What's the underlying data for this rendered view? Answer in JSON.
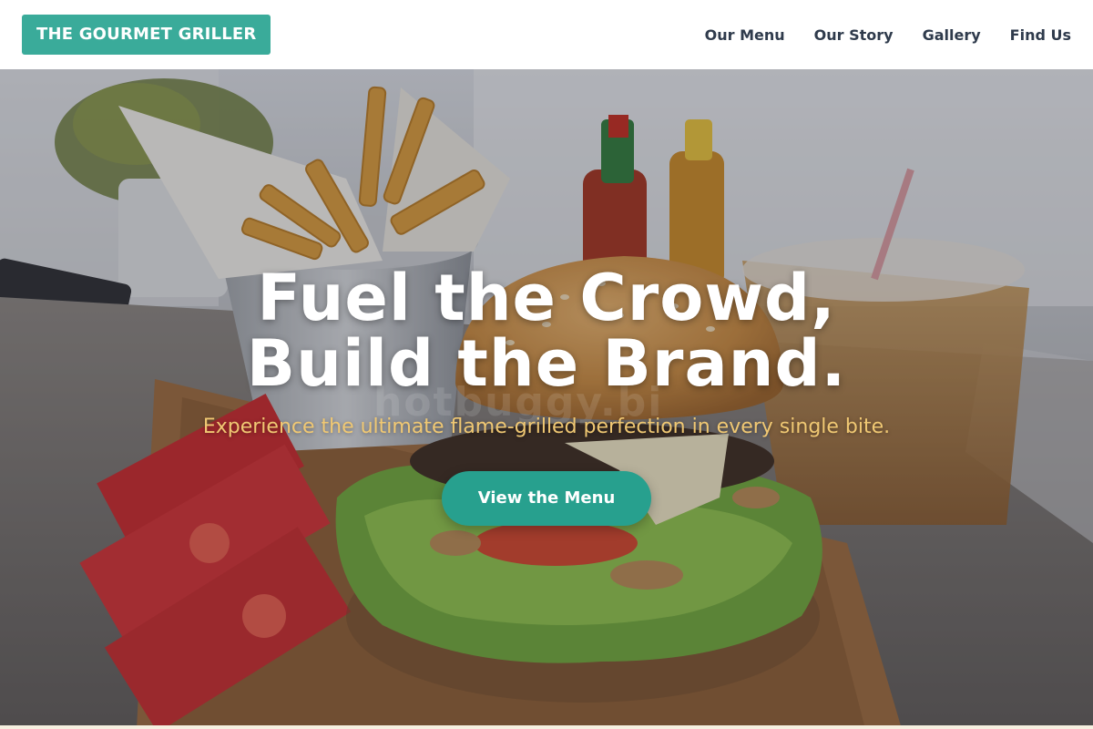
{
  "header": {
    "logo": "THE GOURMET GRILLER",
    "nav": [
      "Our Menu",
      "Our Story",
      "Gallery",
      "Find Us"
    ]
  },
  "hero": {
    "title_line1": "Fuel the Crowd,",
    "title_line2": "Build the Brand.",
    "subtitle": "Experience the ultimate flame-grilled perfection in every single bite.",
    "cta_label": "View the Menu",
    "image_semantic": "burger-fries-drinks-photo"
  },
  "colors": {
    "brand": "#3aab9a",
    "cta": "#27a08e",
    "nav_text": "#2f3b4c",
    "subtitle": "#f0c873"
  }
}
